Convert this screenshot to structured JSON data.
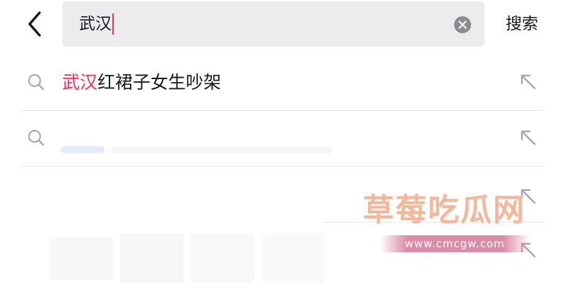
{
  "header": {
    "back_icon": "chevron-left-icon",
    "search": {
      "value": "武汉",
      "clear_icon": "clear-circle-icon"
    },
    "search_button_label": "搜索"
  },
  "suggestions": [
    {
      "highlight": "武汉",
      "rest": "红裙子女生吵架",
      "icon": "search-icon",
      "fill_icon": "arrow-up-left-icon"
    },
    {
      "highlight": "",
      "rest": "",
      "icon": "search-icon",
      "fill_icon": "arrow-up-left-icon"
    },
    {
      "highlight": "",
      "rest": "",
      "icon": "",
      "fill_icon": "arrow-up-left-icon"
    },
    {
      "highlight": "",
      "rest": "",
      "icon": "",
      "fill_icon": "arrow-up-left-icon"
    }
  ],
  "watermark": {
    "title": "草莓吃瓜网",
    "url": "www.cmcgw.com"
  },
  "colors": {
    "accent": "#fe2c55",
    "search_bg": "#ececee",
    "watermark_title": "#f4b79a",
    "watermark_bar": "#d67896"
  }
}
